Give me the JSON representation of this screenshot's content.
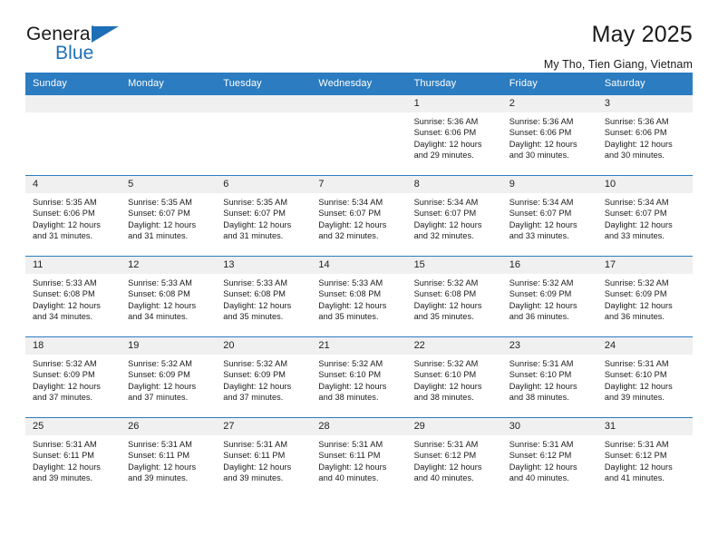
{
  "brand": {
    "name_part1": "General",
    "name_part2": "Blue",
    "triangle_icon": "triangle-icon",
    "accent_color": "#1d70b8"
  },
  "header": {
    "title": "May 2025",
    "subtitle": "My Tho, Tien Giang, Vietnam"
  },
  "theme": {
    "header_row_color": "#2b7cc0",
    "daynum_band_color": "#f0f0f0",
    "grid_line_color": "#2b7cc0"
  },
  "calendar": {
    "weekday_headers": [
      "Sunday",
      "Monday",
      "Tuesday",
      "Wednesday",
      "Thursday",
      "Friday",
      "Saturday"
    ],
    "labels": {
      "sunrise": "Sunrise:",
      "sunset": "Sunset:",
      "daylight": "Daylight:"
    },
    "weeks": [
      [
        {
          "day": "",
          "empty": true,
          "sunrise": "",
          "sunset": "",
          "daylight_line1": "",
          "daylight_line2": ""
        },
        {
          "day": "",
          "empty": true,
          "sunrise": "",
          "sunset": "",
          "daylight_line1": "",
          "daylight_line2": ""
        },
        {
          "day": "",
          "empty": true,
          "sunrise": "",
          "sunset": "",
          "daylight_line1": "",
          "daylight_line2": ""
        },
        {
          "day": "",
          "empty": true,
          "sunrise": "",
          "sunset": "",
          "daylight_line1": "",
          "daylight_line2": ""
        },
        {
          "day": "1",
          "empty": false,
          "sunrise": "Sunrise: 5:36 AM",
          "sunset": "Sunset: 6:06 PM",
          "daylight_line1": "Daylight: 12 hours",
          "daylight_line2": "and 29 minutes."
        },
        {
          "day": "2",
          "empty": false,
          "sunrise": "Sunrise: 5:36 AM",
          "sunset": "Sunset: 6:06 PM",
          "daylight_line1": "Daylight: 12 hours",
          "daylight_line2": "and 30 minutes."
        },
        {
          "day": "3",
          "empty": false,
          "sunrise": "Sunrise: 5:36 AM",
          "sunset": "Sunset: 6:06 PM",
          "daylight_line1": "Daylight: 12 hours",
          "daylight_line2": "and 30 minutes."
        }
      ],
      [
        {
          "day": "4",
          "empty": false,
          "sunrise": "Sunrise: 5:35 AM",
          "sunset": "Sunset: 6:06 PM",
          "daylight_line1": "Daylight: 12 hours",
          "daylight_line2": "and 31 minutes."
        },
        {
          "day": "5",
          "empty": false,
          "sunrise": "Sunrise: 5:35 AM",
          "sunset": "Sunset: 6:07 PM",
          "daylight_line1": "Daylight: 12 hours",
          "daylight_line2": "and 31 minutes."
        },
        {
          "day": "6",
          "empty": false,
          "sunrise": "Sunrise: 5:35 AM",
          "sunset": "Sunset: 6:07 PM",
          "daylight_line1": "Daylight: 12 hours",
          "daylight_line2": "and 31 minutes."
        },
        {
          "day": "7",
          "empty": false,
          "sunrise": "Sunrise: 5:34 AM",
          "sunset": "Sunset: 6:07 PM",
          "daylight_line1": "Daylight: 12 hours",
          "daylight_line2": "and 32 minutes."
        },
        {
          "day": "8",
          "empty": false,
          "sunrise": "Sunrise: 5:34 AM",
          "sunset": "Sunset: 6:07 PM",
          "daylight_line1": "Daylight: 12 hours",
          "daylight_line2": "and 32 minutes."
        },
        {
          "day": "9",
          "empty": false,
          "sunrise": "Sunrise: 5:34 AM",
          "sunset": "Sunset: 6:07 PM",
          "daylight_line1": "Daylight: 12 hours",
          "daylight_line2": "and 33 minutes."
        },
        {
          "day": "10",
          "empty": false,
          "sunrise": "Sunrise: 5:34 AM",
          "sunset": "Sunset: 6:07 PM",
          "daylight_line1": "Daylight: 12 hours",
          "daylight_line2": "and 33 minutes."
        }
      ],
      [
        {
          "day": "11",
          "empty": false,
          "sunrise": "Sunrise: 5:33 AM",
          "sunset": "Sunset: 6:08 PM",
          "daylight_line1": "Daylight: 12 hours",
          "daylight_line2": "and 34 minutes."
        },
        {
          "day": "12",
          "empty": false,
          "sunrise": "Sunrise: 5:33 AM",
          "sunset": "Sunset: 6:08 PM",
          "daylight_line1": "Daylight: 12 hours",
          "daylight_line2": "and 34 minutes."
        },
        {
          "day": "13",
          "empty": false,
          "sunrise": "Sunrise: 5:33 AM",
          "sunset": "Sunset: 6:08 PM",
          "daylight_line1": "Daylight: 12 hours",
          "daylight_line2": "and 35 minutes."
        },
        {
          "day": "14",
          "empty": false,
          "sunrise": "Sunrise: 5:33 AM",
          "sunset": "Sunset: 6:08 PM",
          "daylight_line1": "Daylight: 12 hours",
          "daylight_line2": "and 35 minutes."
        },
        {
          "day": "15",
          "empty": false,
          "sunrise": "Sunrise: 5:32 AM",
          "sunset": "Sunset: 6:08 PM",
          "daylight_line1": "Daylight: 12 hours",
          "daylight_line2": "and 35 minutes."
        },
        {
          "day": "16",
          "empty": false,
          "sunrise": "Sunrise: 5:32 AM",
          "sunset": "Sunset: 6:09 PM",
          "daylight_line1": "Daylight: 12 hours",
          "daylight_line2": "and 36 minutes."
        },
        {
          "day": "17",
          "empty": false,
          "sunrise": "Sunrise: 5:32 AM",
          "sunset": "Sunset: 6:09 PM",
          "daylight_line1": "Daylight: 12 hours",
          "daylight_line2": "and 36 minutes."
        }
      ],
      [
        {
          "day": "18",
          "empty": false,
          "sunrise": "Sunrise: 5:32 AM",
          "sunset": "Sunset: 6:09 PM",
          "daylight_line1": "Daylight: 12 hours",
          "daylight_line2": "and 37 minutes."
        },
        {
          "day": "19",
          "empty": false,
          "sunrise": "Sunrise: 5:32 AM",
          "sunset": "Sunset: 6:09 PM",
          "daylight_line1": "Daylight: 12 hours",
          "daylight_line2": "and 37 minutes."
        },
        {
          "day": "20",
          "empty": false,
          "sunrise": "Sunrise: 5:32 AM",
          "sunset": "Sunset: 6:09 PM",
          "daylight_line1": "Daylight: 12 hours",
          "daylight_line2": "and 37 minutes."
        },
        {
          "day": "21",
          "empty": false,
          "sunrise": "Sunrise: 5:32 AM",
          "sunset": "Sunset: 6:10 PM",
          "daylight_line1": "Daylight: 12 hours",
          "daylight_line2": "and 38 minutes."
        },
        {
          "day": "22",
          "empty": false,
          "sunrise": "Sunrise: 5:32 AM",
          "sunset": "Sunset: 6:10 PM",
          "daylight_line1": "Daylight: 12 hours",
          "daylight_line2": "and 38 minutes."
        },
        {
          "day": "23",
          "empty": false,
          "sunrise": "Sunrise: 5:31 AM",
          "sunset": "Sunset: 6:10 PM",
          "daylight_line1": "Daylight: 12 hours",
          "daylight_line2": "and 38 minutes."
        },
        {
          "day": "24",
          "empty": false,
          "sunrise": "Sunrise: 5:31 AM",
          "sunset": "Sunset: 6:10 PM",
          "daylight_line1": "Daylight: 12 hours",
          "daylight_line2": "and 39 minutes."
        }
      ],
      [
        {
          "day": "25",
          "empty": false,
          "sunrise": "Sunrise: 5:31 AM",
          "sunset": "Sunset: 6:11 PM",
          "daylight_line1": "Daylight: 12 hours",
          "daylight_line2": "and 39 minutes."
        },
        {
          "day": "26",
          "empty": false,
          "sunrise": "Sunrise: 5:31 AM",
          "sunset": "Sunset: 6:11 PM",
          "daylight_line1": "Daylight: 12 hours",
          "daylight_line2": "and 39 minutes."
        },
        {
          "day": "27",
          "empty": false,
          "sunrise": "Sunrise: 5:31 AM",
          "sunset": "Sunset: 6:11 PM",
          "daylight_line1": "Daylight: 12 hours",
          "daylight_line2": "and 39 minutes."
        },
        {
          "day": "28",
          "empty": false,
          "sunrise": "Sunrise: 5:31 AM",
          "sunset": "Sunset: 6:11 PM",
          "daylight_line1": "Daylight: 12 hours",
          "daylight_line2": "and 40 minutes."
        },
        {
          "day": "29",
          "empty": false,
          "sunrise": "Sunrise: 5:31 AM",
          "sunset": "Sunset: 6:12 PM",
          "daylight_line1": "Daylight: 12 hours",
          "daylight_line2": "and 40 minutes."
        },
        {
          "day": "30",
          "empty": false,
          "sunrise": "Sunrise: 5:31 AM",
          "sunset": "Sunset: 6:12 PM",
          "daylight_line1": "Daylight: 12 hours",
          "daylight_line2": "and 40 minutes."
        },
        {
          "day": "31",
          "empty": false,
          "sunrise": "Sunrise: 5:31 AM",
          "sunset": "Sunset: 6:12 PM",
          "daylight_line1": "Daylight: 12 hours",
          "daylight_line2": "and 41 minutes."
        }
      ]
    ]
  }
}
